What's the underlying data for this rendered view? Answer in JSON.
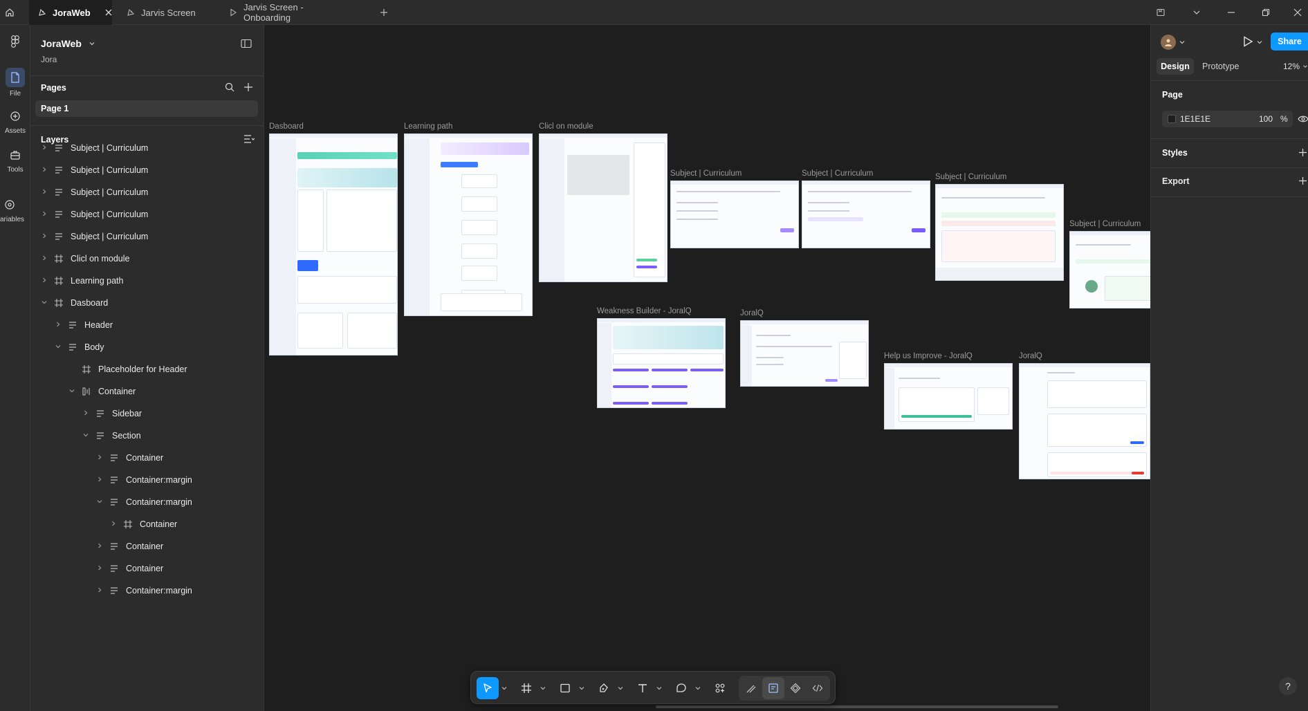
{
  "titlebar": {
    "tabs": [
      {
        "label": "JoraWeb",
        "active": true
      },
      {
        "label": "Jarvis Screen",
        "active": false
      },
      {
        "label": "Jarvis Screen - Onboarding",
        "active": false
      }
    ]
  },
  "rail": {
    "items": [
      {
        "label": "File",
        "icon": "file-icon",
        "active": true
      },
      {
        "label": "Assets",
        "icon": "assets-icon"
      },
      {
        "label": "Tools",
        "icon": "tools-icon"
      },
      {
        "label": "ariables",
        "icon": "variables-icon"
      }
    ]
  },
  "leftpanel": {
    "file_name": "JoraWeb",
    "team": "Jora",
    "pages_title": "Pages",
    "page_1": "Page 1",
    "layers_title": "Layers",
    "layers": [
      {
        "label": "Subject | Curriculum",
        "indent": 0,
        "icon": "section",
        "chev": "right"
      },
      {
        "label": "Subject | Curriculum",
        "indent": 0,
        "icon": "section",
        "chev": "right"
      },
      {
        "label": "Subject | Curriculum",
        "indent": 0,
        "icon": "section",
        "chev": "right"
      },
      {
        "label": "Subject | Curriculum",
        "indent": 0,
        "icon": "section",
        "chev": "right"
      },
      {
        "label": "Subject | Curriculum",
        "indent": 0,
        "icon": "section",
        "chev": "right"
      },
      {
        "label": "Clicl on module",
        "indent": 0,
        "icon": "frame",
        "chev": "right"
      },
      {
        "label": "Learning path",
        "indent": 0,
        "icon": "frame",
        "chev": "right"
      },
      {
        "label": "Dasboard",
        "indent": 0,
        "icon": "frame",
        "chev": "down"
      },
      {
        "label": "Header",
        "indent": 1,
        "icon": "section",
        "chev": "right"
      },
      {
        "label": "Body",
        "indent": 1,
        "icon": "section",
        "chev": "down"
      },
      {
        "label": "Placeholder for Header",
        "indent": 2,
        "icon": "frame",
        "chev": "none"
      },
      {
        "label": "Container",
        "indent": 2,
        "icon": "autolayout",
        "chev": "down"
      },
      {
        "label": "Sidebar",
        "indent": 3,
        "icon": "section",
        "chev": "right"
      },
      {
        "label": "Section",
        "indent": 3,
        "icon": "section",
        "chev": "down"
      },
      {
        "label": "Container",
        "indent": 4,
        "icon": "section",
        "chev": "right"
      },
      {
        "label": "Container:margin",
        "indent": 4,
        "icon": "section",
        "chev": "right"
      },
      {
        "label": "Container:margin",
        "indent": 4,
        "icon": "section",
        "chev": "down"
      },
      {
        "label": "Container",
        "indent": 5,
        "icon": "frame",
        "chev": "right"
      },
      {
        "label": "Container",
        "indent": 4,
        "icon": "section",
        "chev": "right"
      },
      {
        "label": "Container",
        "indent": 4,
        "icon": "section",
        "chev": "right"
      },
      {
        "label": "Container:margin",
        "indent": 4,
        "icon": "section",
        "chev": "right"
      }
    ]
  },
  "canvas": {
    "frames": [
      {
        "label": "Dasboard"
      },
      {
        "label": "Learning path"
      },
      {
        "label": "Clicl on module"
      },
      {
        "label": "Subject | Curriculum"
      },
      {
        "label": "Subject | Curriculum"
      },
      {
        "label": "Subject | Curriculum"
      },
      {
        "label": "Subject | Curriculum"
      },
      {
        "label": "Weakness Builder - JoralQ"
      },
      {
        "label": "JoralQ"
      },
      {
        "label": "Help us Improve - JoralQ"
      },
      {
        "label": "JoralQ"
      }
    ]
  },
  "rightpanel": {
    "share": "Share",
    "tab_design": "Design",
    "tab_prototype": "Prototype",
    "zoom": "12%",
    "page_title": "Page",
    "page_color": "1E1E1E",
    "page_opacity": "100",
    "percent": "%",
    "styles": "Styles",
    "export": "Export"
  },
  "colors": {
    "canvas_bg": "#1e1e1e",
    "panel_bg": "#2c2c2c",
    "accent_blue": "#0d99ff",
    "active_rail": "#3b4a66"
  }
}
